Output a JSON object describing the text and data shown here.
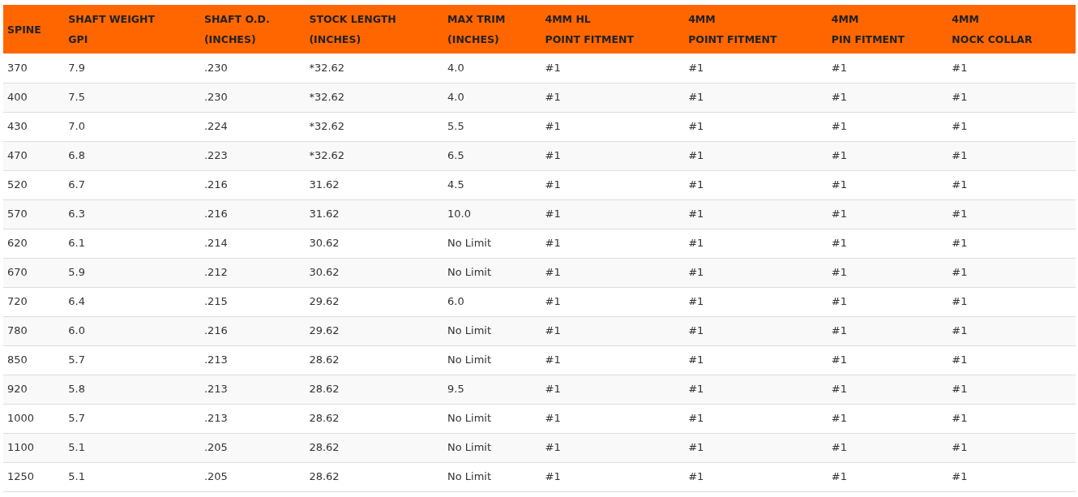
{
  "table": {
    "columns": [
      {
        "lines": [
          "SPINE"
        ]
      },
      {
        "lines": [
          "SHAFT WEIGHT",
          "GPI"
        ]
      },
      {
        "lines": [
          "SHAFT O.D.",
          "(INCHES)"
        ]
      },
      {
        "lines": [
          "STOCK LENGTH",
          "(INCHES)"
        ]
      },
      {
        "lines": [
          "MAX TRIM",
          "(INCHES)"
        ]
      },
      {
        "lines": [
          "4MM HL",
          "POINT FITMENT"
        ]
      },
      {
        "lines": [
          "4MM",
          "POINT FITMENT"
        ]
      },
      {
        "lines": [
          "4MM",
          "PIN FITMENT"
        ]
      },
      {
        "lines": [
          "4MM",
          "NOCK COLLAR"
        ]
      }
    ],
    "rows": [
      [
        "370",
        "7.9",
        ".230",
        "*32.62",
        "4.0",
        "#1",
        "#1",
        "#1",
        "#1"
      ],
      [
        "400",
        "7.5",
        ".230",
        "*32.62",
        "4.0",
        "#1",
        "#1",
        "#1",
        "#1"
      ],
      [
        "430",
        "7.0",
        ".224",
        "*32.62",
        "5.5",
        "#1",
        "#1",
        "#1",
        "#1"
      ],
      [
        "470",
        "6.8",
        ".223",
        "*32.62",
        "6.5",
        "#1",
        "#1",
        "#1",
        "#1"
      ],
      [
        "520",
        "6.7",
        ".216",
        "31.62",
        "4.5",
        "#1",
        "#1",
        "#1",
        "#1"
      ],
      [
        "570",
        "6.3",
        ".216",
        "31.62",
        "10.0",
        "#1",
        "#1",
        "#1",
        "#1"
      ],
      [
        "620",
        "6.1",
        ".214",
        "30.62",
        "No Limit",
        "#1",
        "#1",
        "#1",
        "#1"
      ],
      [
        "670",
        "5.9",
        ".212",
        "30.62",
        "No Limit",
        "#1",
        "#1",
        "#1",
        "#1"
      ],
      [
        "720",
        "6.4",
        ".215",
        "29.62",
        "6.0",
        "#1",
        "#1",
        "#1",
        "#1"
      ],
      [
        "780",
        "6.0",
        ".216",
        "29.62",
        "No Limit",
        "#1",
        "#1",
        "#1",
        "#1"
      ],
      [
        "850",
        "5.7",
        ".213",
        "28.62",
        "No Limit",
        "#1",
        "#1",
        "#1",
        "#1"
      ],
      [
        "920",
        "5.8",
        ".213",
        "28.62",
        "9.5",
        "#1",
        "#1",
        "#1",
        "#1"
      ],
      [
        "1000",
        "5.7",
        ".213",
        "28.62",
        "No Limit",
        "#1",
        "#1",
        "#1",
        "#1"
      ],
      [
        "1100",
        "5.1",
        ".205",
        "28.62",
        "No Limit",
        "#1",
        "#1",
        "#1",
        "#1"
      ],
      [
        "1250",
        "5.1",
        ".205",
        "28.62",
        "No Limit",
        "#1",
        "#1",
        "#1",
        "#1"
      ]
    ]
  }
}
